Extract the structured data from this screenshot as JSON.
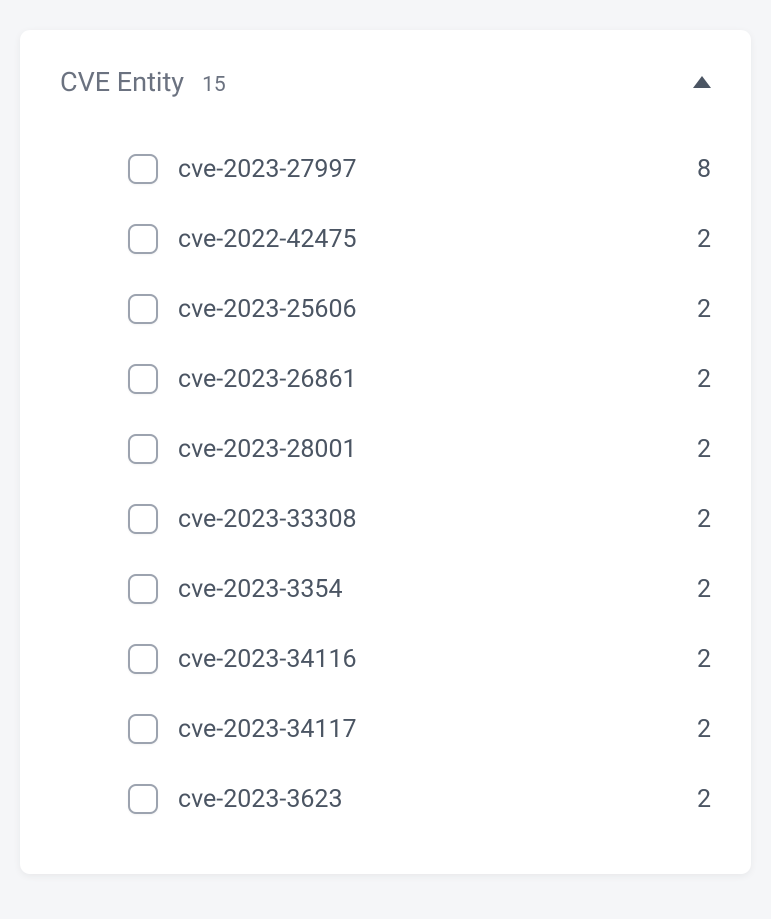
{
  "panel": {
    "title": "CVE Entity",
    "total_count": "15",
    "items": [
      {
        "label": "cve-2023-27997",
        "count": "8"
      },
      {
        "label": "cve-2022-42475",
        "count": "2"
      },
      {
        "label": "cve-2023-25606",
        "count": "2"
      },
      {
        "label": "cve-2023-26861",
        "count": "2"
      },
      {
        "label": "cve-2023-28001",
        "count": "2"
      },
      {
        "label": "cve-2023-33308",
        "count": "2"
      },
      {
        "label": "cve-2023-3354",
        "count": "2"
      },
      {
        "label": "cve-2023-34116",
        "count": "2"
      },
      {
        "label": "cve-2023-34117",
        "count": "2"
      },
      {
        "label": "cve-2023-3623",
        "count": "2"
      }
    ]
  }
}
